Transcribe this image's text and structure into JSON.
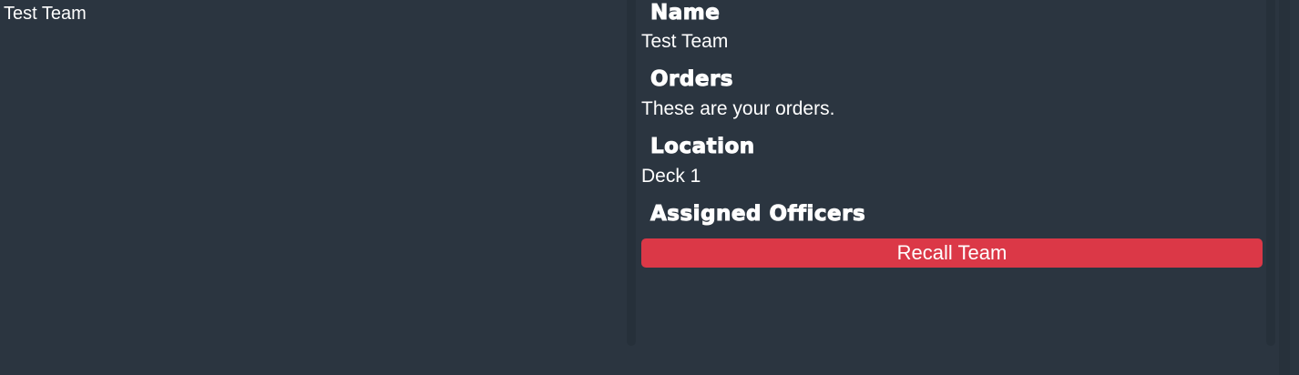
{
  "team_list": {
    "items": [
      {
        "label": "Test Team"
      }
    ]
  },
  "details": {
    "name_heading": "Name",
    "name_value": "Test Team",
    "orders_heading": "Orders",
    "orders_value": "These are your orders.",
    "location_heading": "Location",
    "location_value": "Deck 1",
    "officers_heading": "Assigned Officers",
    "recall_label": "Recall Team"
  },
  "colors": {
    "background": "#2b3540",
    "text": "#ffffff",
    "danger": "#db3847",
    "scroll_track": "#26303a"
  }
}
